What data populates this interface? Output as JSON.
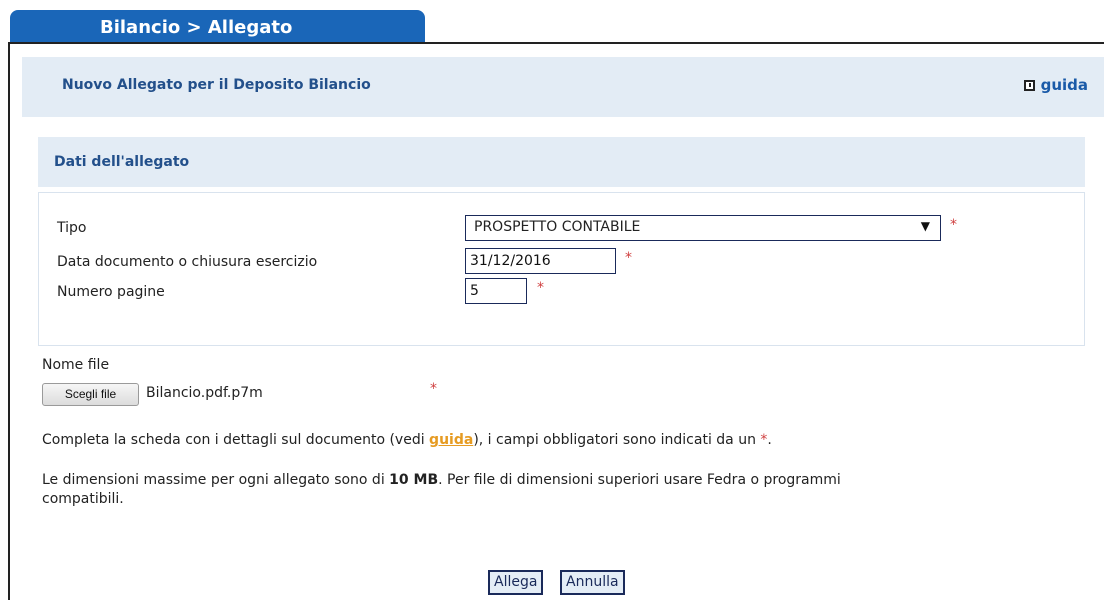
{
  "tab": {
    "title": "Bilancio > Allegato"
  },
  "header": {
    "title": "Nuovo Allegato per il Deposito Bilancio",
    "help_label": "guida"
  },
  "section": {
    "title": "Dati dell'allegato"
  },
  "form": {
    "tipo_label": "Tipo",
    "tipo_value": "PROSPETTO CONTABILE",
    "data_label": "Data documento o chiusura esercizio",
    "data_value": "31/12/2016",
    "pagine_label": "Numero pagine",
    "pagine_value": "5",
    "required_mark": "*"
  },
  "file": {
    "label": "Nome file",
    "button_label": "Scegli file",
    "file_name": "Bilancio.pdf.p7m"
  },
  "info": {
    "line1_pre": "Completa la scheda con i dettagli sul documento (vedi ",
    "line1_link": "guida",
    "line1_mid": "), i campi obbligatori sono indicati da un ",
    "line1_star": "*",
    "line1_end": ".",
    "line2_pre": "Le dimensioni massime per ogni allegato sono di ",
    "line2_bold": "10 MB",
    "line2_post": ". Per file di dimensioni superiori usare Fedra o programmi",
    "line3": "compatibili."
  },
  "actions": {
    "submit_label": "Allega",
    "cancel_label": "Annulla"
  },
  "colors": {
    "tab": "#1a66b8",
    "header_bg": "#e3ecf5",
    "title": "#23508b",
    "link": "#e69b22",
    "required": "#d04040"
  }
}
